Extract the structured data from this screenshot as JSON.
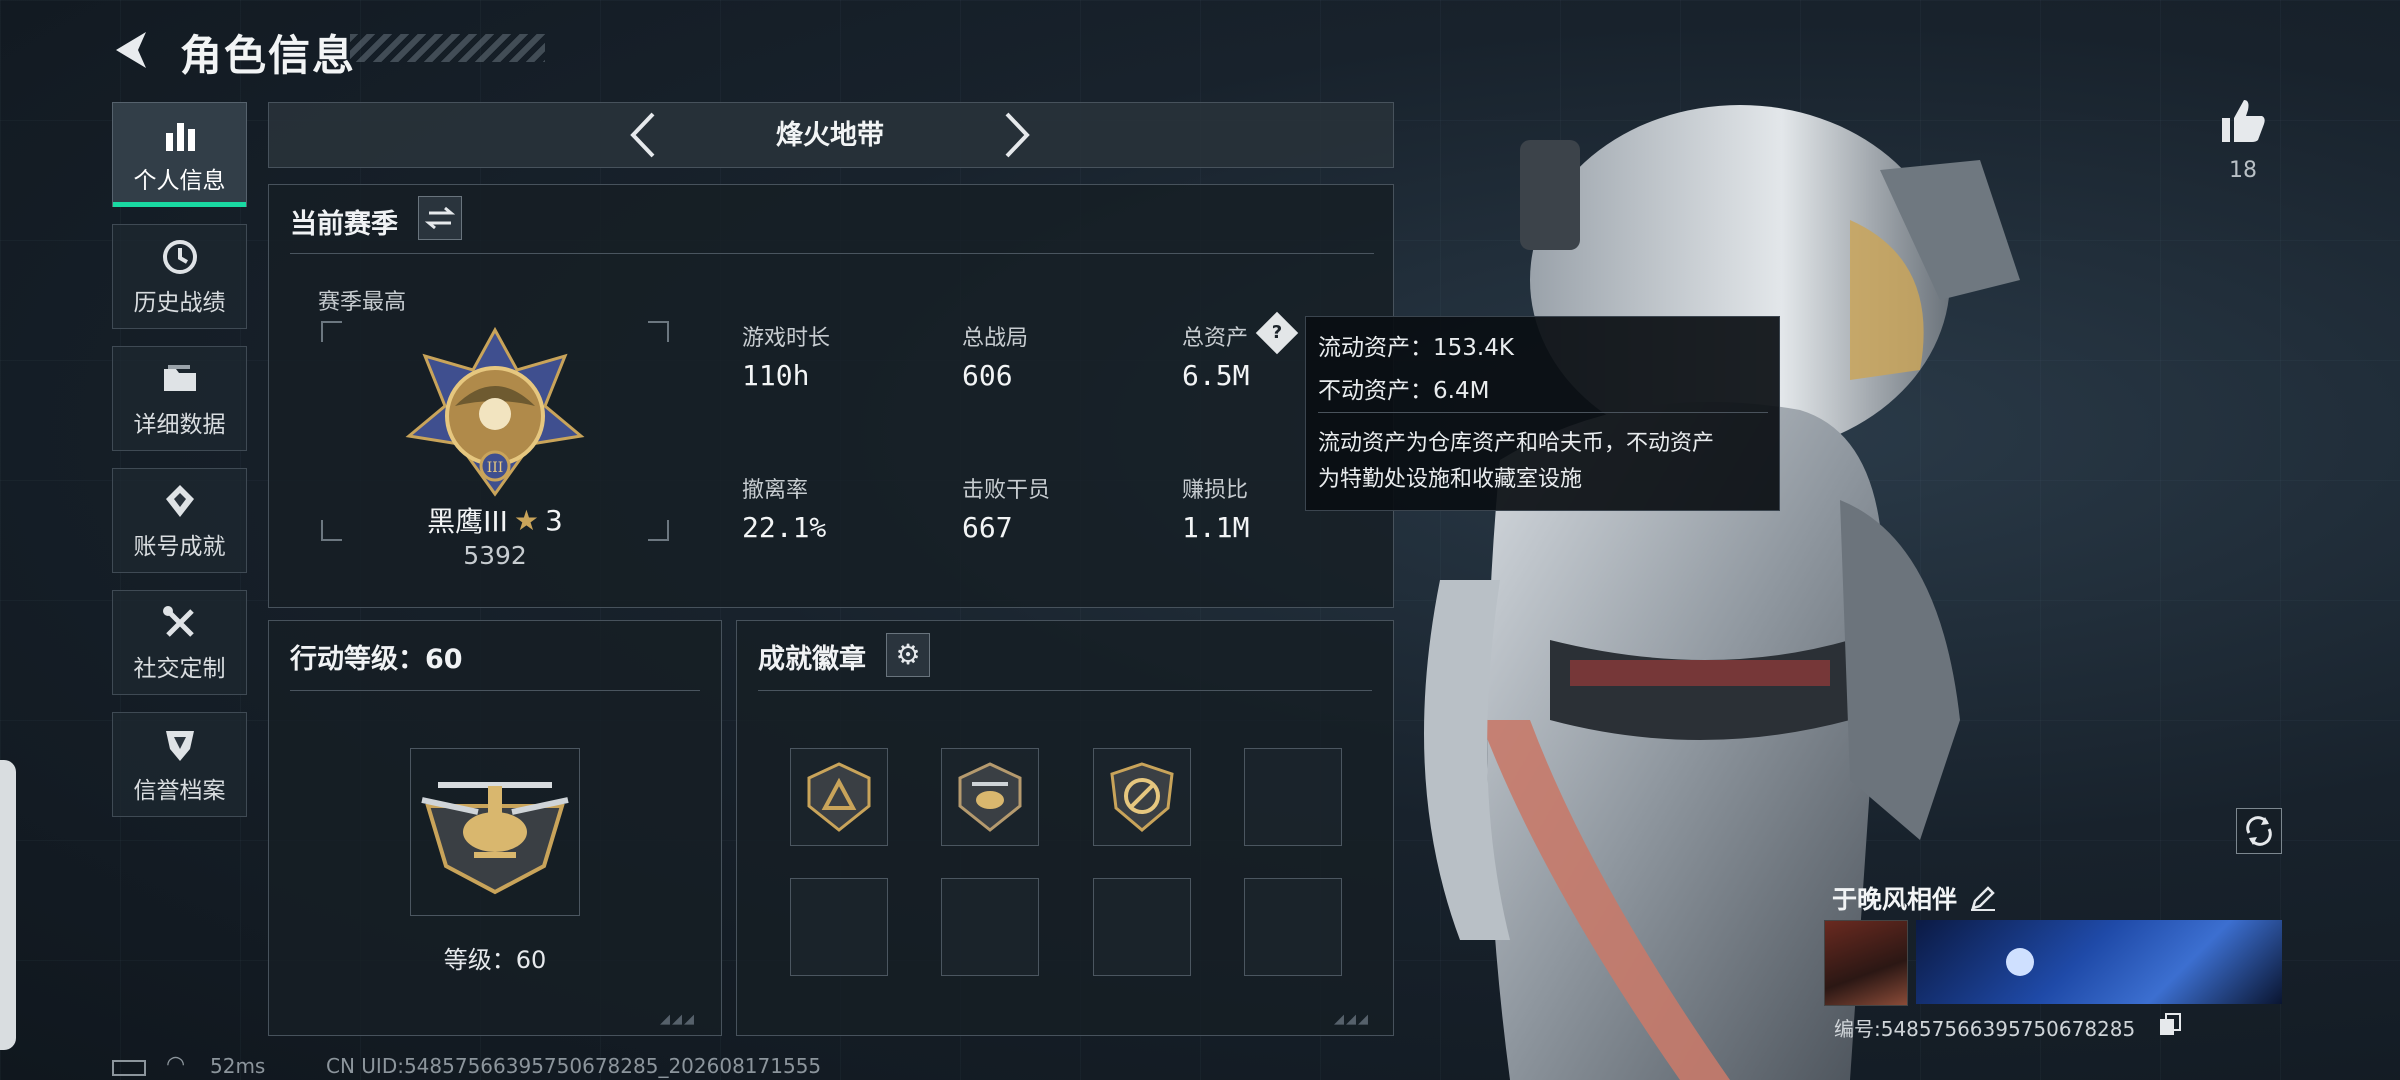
{
  "header": {
    "title": "角色信息"
  },
  "sidebar": {
    "items": [
      {
        "label": "个人信息",
        "icon": "bar-chart-icon",
        "active": true
      },
      {
        "label": "历史战绩",
        "icon": "history-clock-icon"
      },
      {
        "label": "详细数据",
        "icon": "folder-icon"
      },
      {
        "label": "账号成就",
        "icon": "achievement-icon"
      },
      {
        "label": "社交定制",
        "icon": "tools-icon"
      },
      {
        "label": "信誉档案",
        "icon": "shield-icon"
      }
    ]
  },
  "mode": {
    "title": "烽火地带"
  },
  "season": {
    "title": "当前赛季",
    "best_label": "赛季最高",
    "rank_name": "黑鹰III",
    "rank_stars": "3",
    "rank_score": "5392",
    "stats": [
      {
        "label": "游戏时长",
        "value": "110h"
      },
      {
        "label": "总战局",
        "value": "606"
      },
      {
        "label": "总资产",
        "value": "6.5M"
      },
      {
        "label": "撤离率",
        "value": "22.1%"
      },
      {
        "label": "击败干员",
        "value": "667"
      },
      {
        "label": "赚损比",
        "value": "1.1M"
      }
    ]
  },
  "tooltip": {
    "liquid": "流动资产：153.4K",
    "fixed": "不动资产：6.4M",
    "desc_line1": "流动资产为仓库资产和哈夫币，不动资产",
    "desc_line2": "为特勤处设施和收藏室设施"
  },
  "action_level": {
    "title": "行动等级：60",
    "level_label": "等级：60"
  },
  "achievements": {
    "title": "成就徽章"
  },
  "likes": {
    "count": "18"
  },
  "player": {
    "name": "于晚风相伴",
    "id_text": "编号:54857566395750678285"
  },
  "status": {
    "ping": "52ms",
    "uid": "CN UID:54857566395750678285_202608171555"
  },
  "colors": {
    "accent": "#19d9a2",
    "panel_border": "#47525c",
    "gold": "#c9a45a"
  }
}
